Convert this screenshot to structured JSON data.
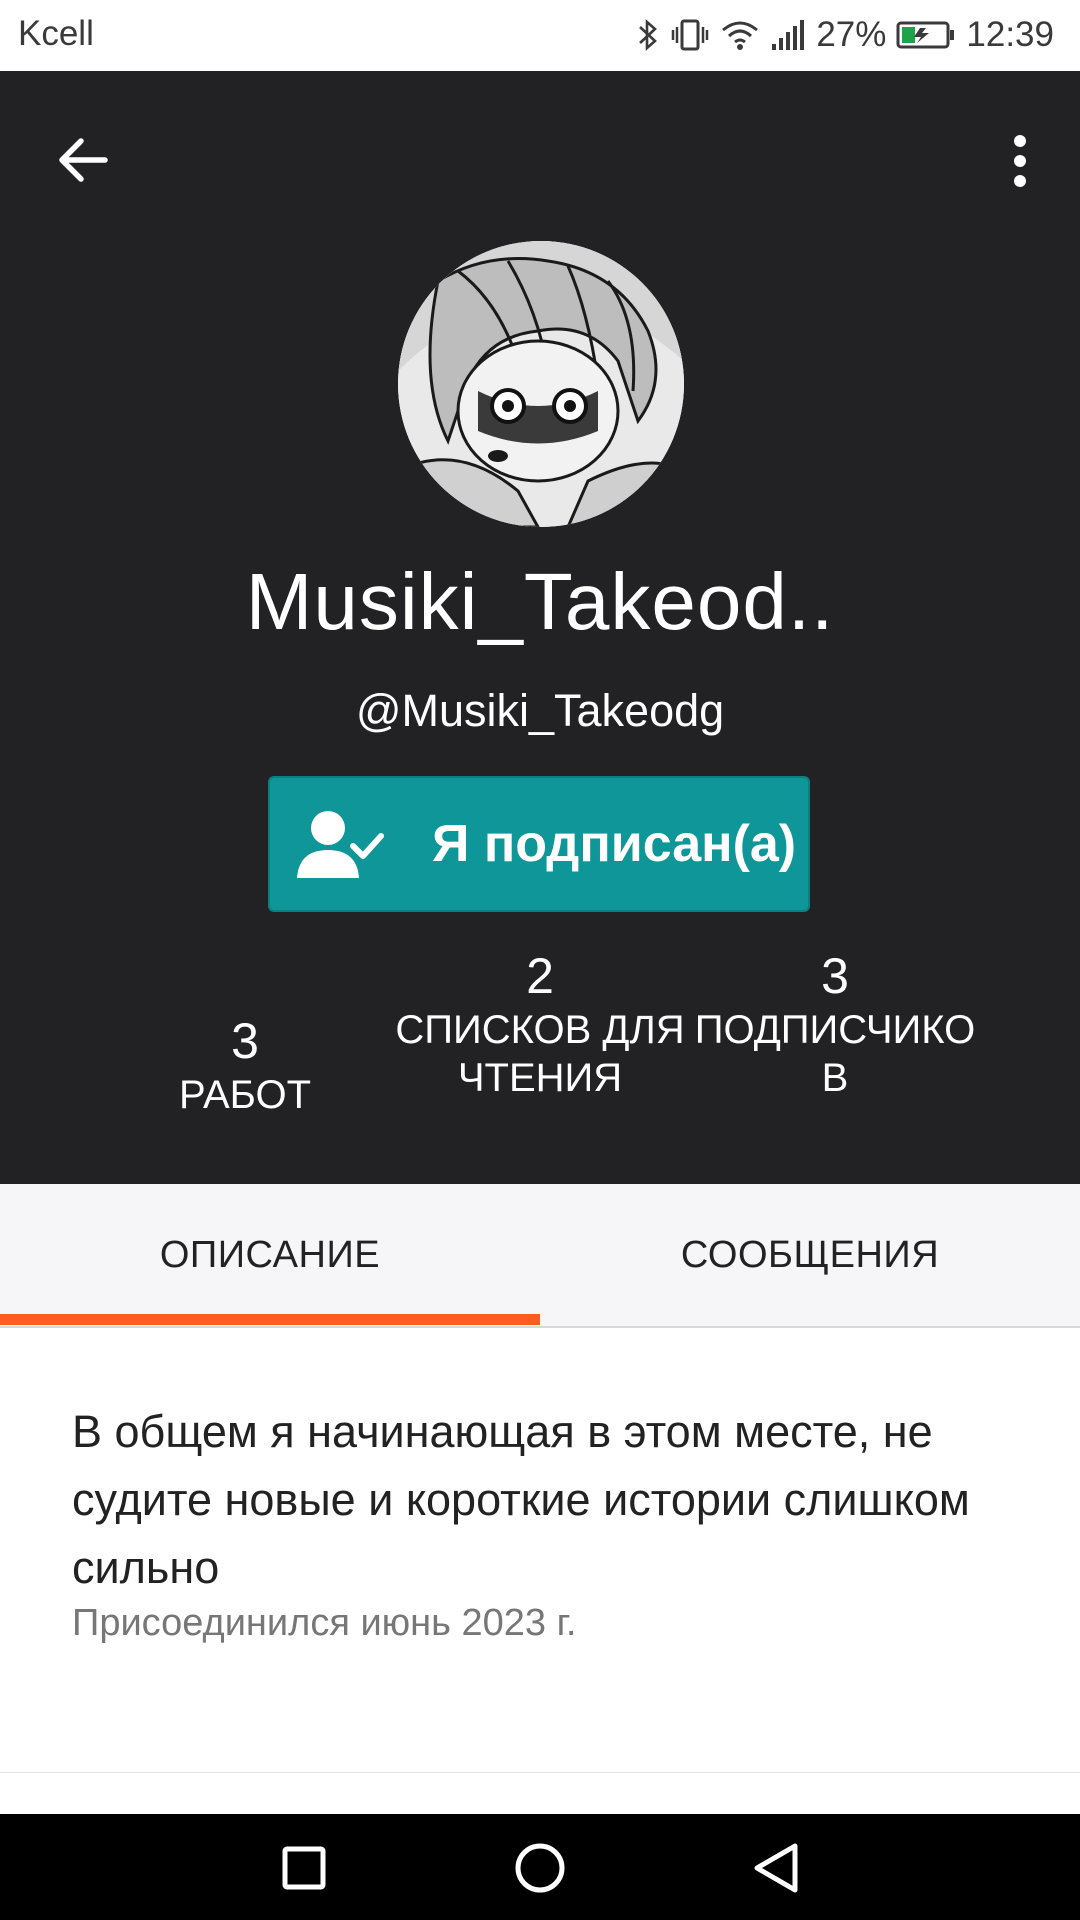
{
  "status_bar": {
    "carrier": "Kcell",
    "battery": "27%",
    "time": "12:39",
    "icons": [
      "bluetooth-icon",
      "vibrate-icon",
      "wifi-icon",
      "signal-icon",
      "battery-icon"
    ]
  },
  "header": {
    "back_icon": "arrow-left-icon",
    "more_icon": "more-vertical-icon",
    "display_name": "Musiki_Takeod..",
    "username": "@Musiki_Takeodg",
    "follow_button": {
      "label": "Я подписан(а)",
      "icon": "user-check-icon",
      "color": "#0e9698"
    }
  },
  "stats": [
    {
      "value": "3",
      "label_line1": "РАБОТ",
      "label_line2": ""
    },
    {
      "value": "2",
      "label_line1": "СПИСКОВ ДЛЯ",
      "label_line2": "ЧТЕНИЯ"
    },
    {
      "value": "3",
      "label_line1": "ПОДПИСЧИКО",
      "label_line2": "В"
    }
  ],
  "tabs": [
    {
      "label": "ОПИСАНИЕ",
      "active": true
    },
    {
      "label": "СООБЩЕНИЯ",
      "active": false
    }
  ],
  "accent_color": "#ff5a1f",
  "description": {
    "text": "В общем я начинающая в этом месте, не судите новые и короткие истории слишком сильно",
    "joined": "Присоединился июнь 2023 г."
  },
  "nav_bar": {
    "icons": [
      "recent-apps-icon",
      "home-icon",
      "back-icon"
    ]
  }
}
